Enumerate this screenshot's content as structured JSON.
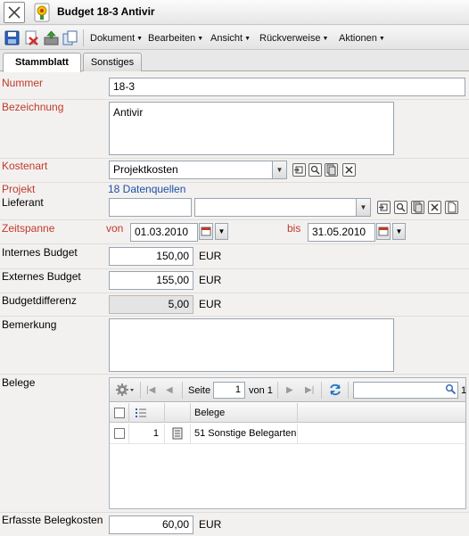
{
  "window": {
    "title": "Budget 18-3 Antivir"
  },
  "toolbar": {
    "icons": [
      "save-icon",
      "delete-icon",
      "export-icon",
      "copy-icon"
    ],
    "menus": [
      "Dokument",
      "Bearbeiten",
      "Ansicht",
      "Rückverweise",
      "Aktionen"
    ]
  },
  "tabs": [
    "Stammblatt",
    "Sonstiges"
  ],
  "form": {
    "nummer": {
      "label": "Nummer",
      "value": "18-3"
    },
    "bezeichnung": {
      "label": "Bezeichnung",
      "value": "Antivir"
    },
    "kostenart": {
      "label": "Kostenart",
      "value": "Projektkosten"
    },
    "projekt": {
      "label": "Projekt",
      "value": "18 Datenquellen"
    },
    "lieferant": {
      "label": "Lieferant",
      "value": "",
      "value2": ""
    },
    "zeitspanne": {
      "label": "Zeitspanne",
      "von_label": "von",
      "von": "01.03.2010",
      "bis_label": "bis",
      "bis": "31.05.2010"
    },
    "internes_budget": {
      "label": "Internes Budget",
      "value": "150,00",
      "unit": "EUR"
    },
    "externes_budget": {
      "label": "Externes Budget",
      "value": "155,00",
      "unit": "EUR"
    },
    "budgetdifferenz": {
      "label": "Budgetdifferenz",
      "value": "5,00",
      "unit": "EUR"
    },
    "bemerkung": {
      "label": "Bemerkung",
      "value": ""
    },
    "belege": {
      "label": "Belege",
      "pager": {
        "seite_label": "Seite",
        "page": "1",
        "von_label": "von 1",
        "search": "",
        "trailing": "1"
      },
      "columns": [
        "Belege"
      ],
      "rows": [
        {
          "num": "1",
          "belege": "51 Sonstige Belegarten"
        }
      ]
    },
    "erfasste_belegkosten": {
      "label": "Erfasste Belegkosten",
      "value": "60,00",
      "unit": "EUR"
    }
  },
  "colors": {
    "required_label": "#c0392b",
    "link": "#1b4fa8"
  }
}
